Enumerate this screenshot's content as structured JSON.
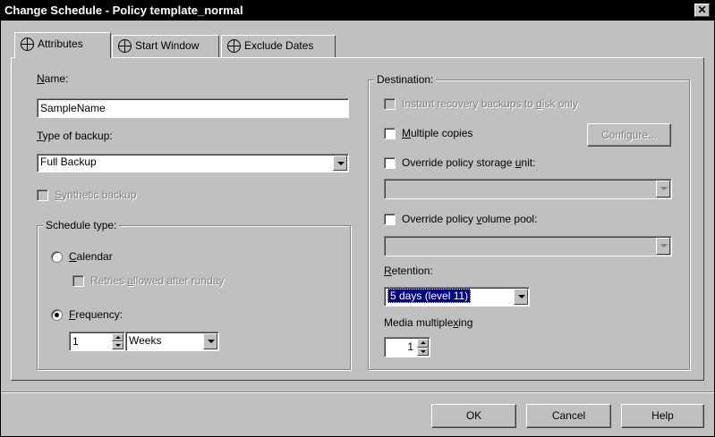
{
  "window": {
    "title": "Change Schedule - Policy template_normal",
    "close_glyph": "✕"
  },
  "tabs": [
    {
      "label": "Attributes",
      "icon": "globe-icon",
      "active": true
    },
    {
      "label": "Start Window",
      "icon": "globe-icon",
      "active": false
    },
    {
      "label": "Exclude Dates",
      "icon": "globe-icon",
      "active": false
    }
  ],
  "form": {
    "name_label_u": "N",
    "name_label_rest": "ame:",
    "name_value": "SampleName",
    "type_label_u": "T",
    "type_label_rest": "ype of backup:",
    "type_value": "Full Backup",
    "synthetic_u": "S",
    "synthetic_rest": "ynthetic backup",
    "schedule_type_title": "Schedule type:",
    "calendar_u": "C",
    "calendar_rest": "alendar",
    "retries_pre": "Retries ",
    "retries_u": "a",
    "retries_rest": "llowed after runday",
    "frequency_u": "F",
    "frequency_rest": "requency:",
    "frequency_value": "1",
    "frequency_unit": "Weeks"
  },
  "destination": {
    "title": "Destination:",
    "instant_pre": "Instant recovery backups to ",
    "instant_u": "d",
    "instant_rest": "isk only",
    "multiple_u": "M",
    "multiple_rest": "ultiple copies",
    "configure_label": "Configure...",
    "override_su_pre": "Override policy storage ",
    "override_su_u": "u",
    "override_su_rest": "nit:",
    "storage_unit_value": "",
    "override_vp_pre": "Override policy ",
    "override_vp_u": "v",
    "override_vp_rest": "olume pool:",
    "volume_pool_value": "",
    "retention_u": "R",
    "retention_rest": "etention:",
    "retention_value": "5 days (level 11)",
    "multiplex_pre": "Media multiple",
    "multiplex_u": "x",
    "multiplex_rest": "ing",
    "multiplex_value": "1"
  },
  "buttons": {
    "ok": "OK",
    "cancel": "Cancel",
    "help": "Help"
  }
}
